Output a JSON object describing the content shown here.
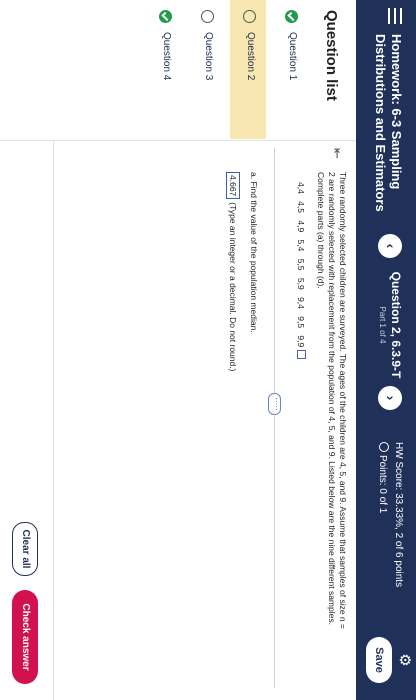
{
  "header": {
    "hw_title": "Homework: 6-3 Sampling Distributions and Estimators",
    "question_title": "Question 2, 6.3.9-T",
    "part": "Part 1 of 4",
    "hw_score": "HW Score: 33.33%, 2 of 6 points",
    "points": "Points: 0 of 1",
    "save_label": "Save",
    "prev_icon": "chevron-left-icon",
    "next_icon": "chevron-right-icon",
    "settings_icon": "gear-icon"
  },
  "sidebar": {
    "heading": "Question list",
    "items": [
      {
        "label": "Question 1",
        "status": "complete"
      },
      {
        "label": "Question 2",
        "status": "current"
      },
      {
        "label": "Question 3",
        "status": "incomplete"
      },
      {
        "label": "Question 4",
        "status": "complete"
      }
    ]
  },
  "question": {
    "prompt": "Three randomly selected children are surveyed. The ages of the children are 4, 5, and 9. Assume that samples of size n = 2 are randomly selected with replacement from the population of 4, 5, and 9. Listed below are the nine different samples. Complete parts (a) through (d).",
    "samples": "4,4  4,5  4,9  5,4  5,5  5,9  9,4  9,5  9,9",
    "more_label": "·····",
    "part_a": "a. Find the value of the population median.",
    "answer_value": "4.667",
    "answer_hint": "(Type an integer or a decimal. Do not round.)"
  },
  "footer": {
    "clear_label": "Clear all",
    "check_label": "Check answer"
  },
  "colors": {
    "navy": "#1f3158",
    "green": "#1f9c4a",
    "highlight": "#f8e7b0",
    "pink": "#d1124f"
  }
}
